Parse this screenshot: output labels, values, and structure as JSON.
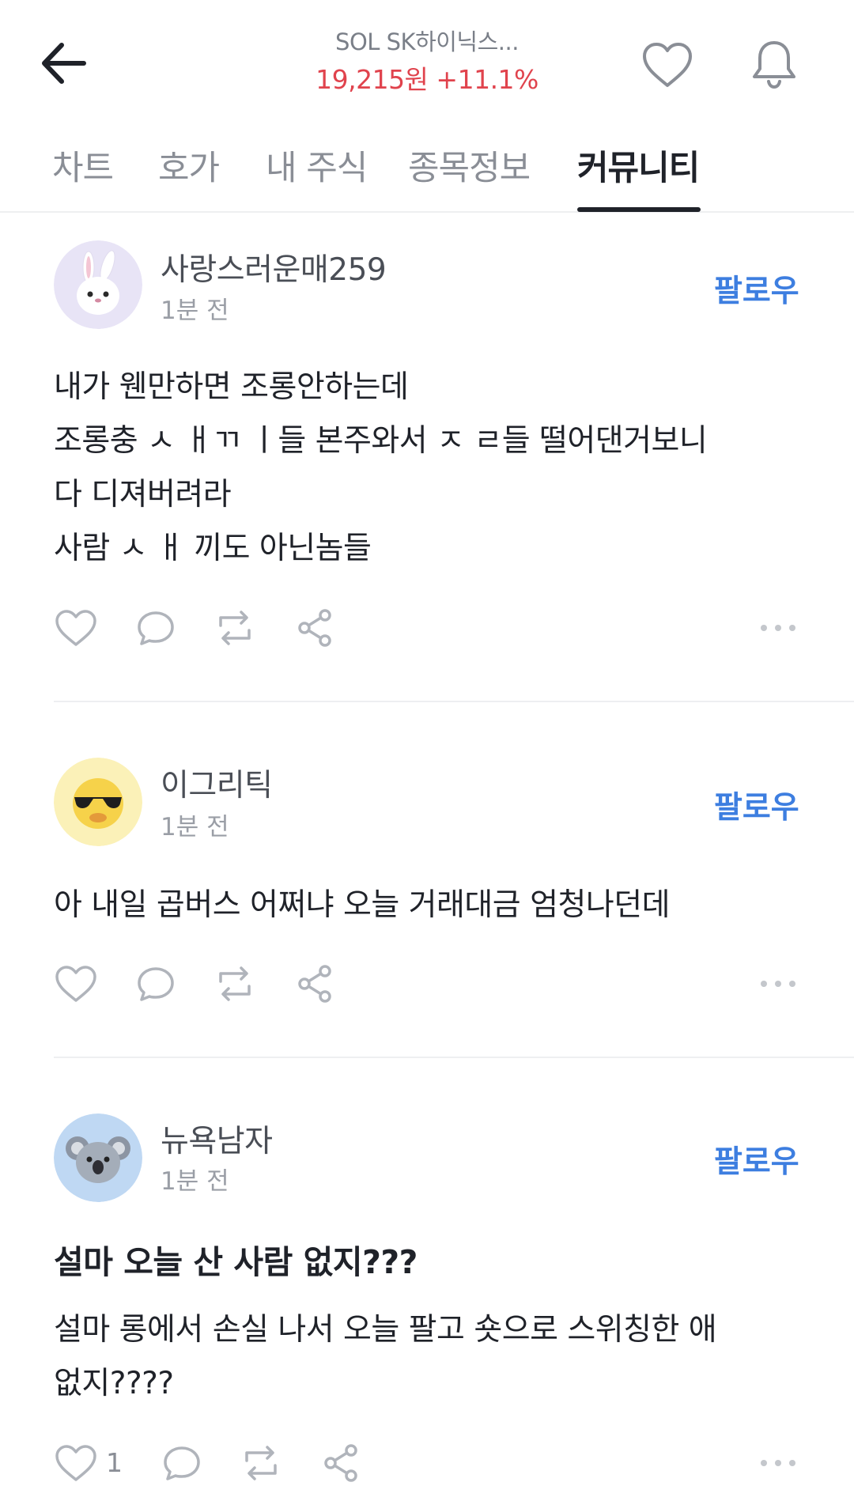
{
  "header": {
    "stock_name": "SOL SK하이닉스...",
    "price": "19,215원",
    "change": "+11.1%"
  },
  "tabs": [
    {
      "label": "차트"
    },
    {
      "label": "호가"
    },
    {
      "label": "내 주식"
    },
    {
      "label": "종목정보"
    },
    {
      "label": "커뮤니티",
      "active": true
    }
  ],
  "posts": [
    {
      "username": "사랑스러운매259",
      "time": "1분 전",
      "follow_label": "팔로우",
      "avatar_icon": "rabbit-avatar",
      "title": "",
      "lines": [
        "내가 웬만하면 조롱안하는데",
        "조롱충 ㅅ ㅐㄲ ㅣ들  본주와서 ㅈ ㄹ들 떨어댄거보니",
        "다 디져버려라",
        "사람 ㅅ ㅐ 끼도 아닌놈들"
      ],
      "like_count": ""
    },
    {
      "username": "이그리틱",
      "time": "1분 전",
      "follow_label": "팔로우",
      "avatar_icon": "sunglasses-emoji-avatar",
      "title": "",
      "lines": [
        "아 내일 곱버스 어쩌냐 오늘 거래대금 엄청나던데"
      ],
      "like_count": ""
    },
    {
      "username": "뉴욕남자",
      "time": "1분 전",
      "follow_label": "팔로우",
      "avatar_icon": "koala-avatar",
      "title": "설마 오늘 산 사람 없지???",
      "lines": [
        "설마 롱에서 손실 나서 오늘 팔고 숏으로 스위칭한 애",
        "없지????"
      ],
      "like_count": "1"
    }
  ],
  "colors": {
    "price_up": "#e0434d",
    "follow": "#3d7ee0",
    "text_primary": "#1f2229",
    "text_secondary": "#8a8e96"
  }
}
